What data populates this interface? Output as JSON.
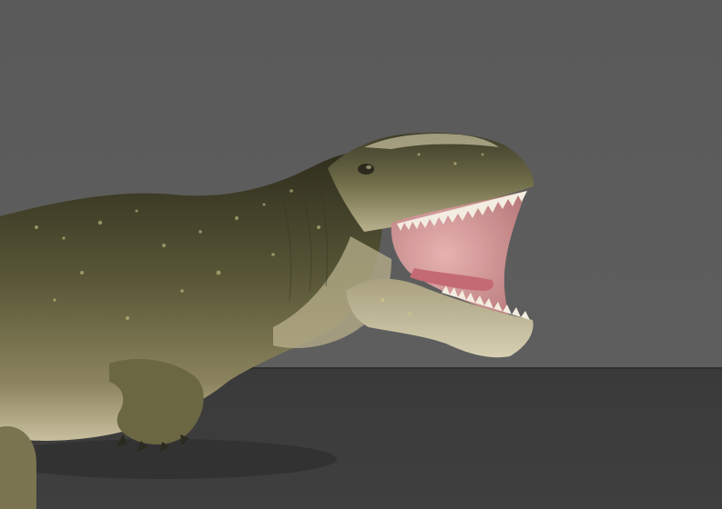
{
  "scene": {
    "subject": "dinosaur-render",
    "colors": {
      "backdrop": "#5b5b5b",
      "floor": "#3c3c3c",
      "skin_dark": "#3b3a26",
      "skin_mid": "#6b6a45",
      "skin_light": "#c9c2a2",
      "mouth": "#d99a9c",
      "tongue": "#c9747c",
      "teeth": "#f3ece0"
    }
  }
}
